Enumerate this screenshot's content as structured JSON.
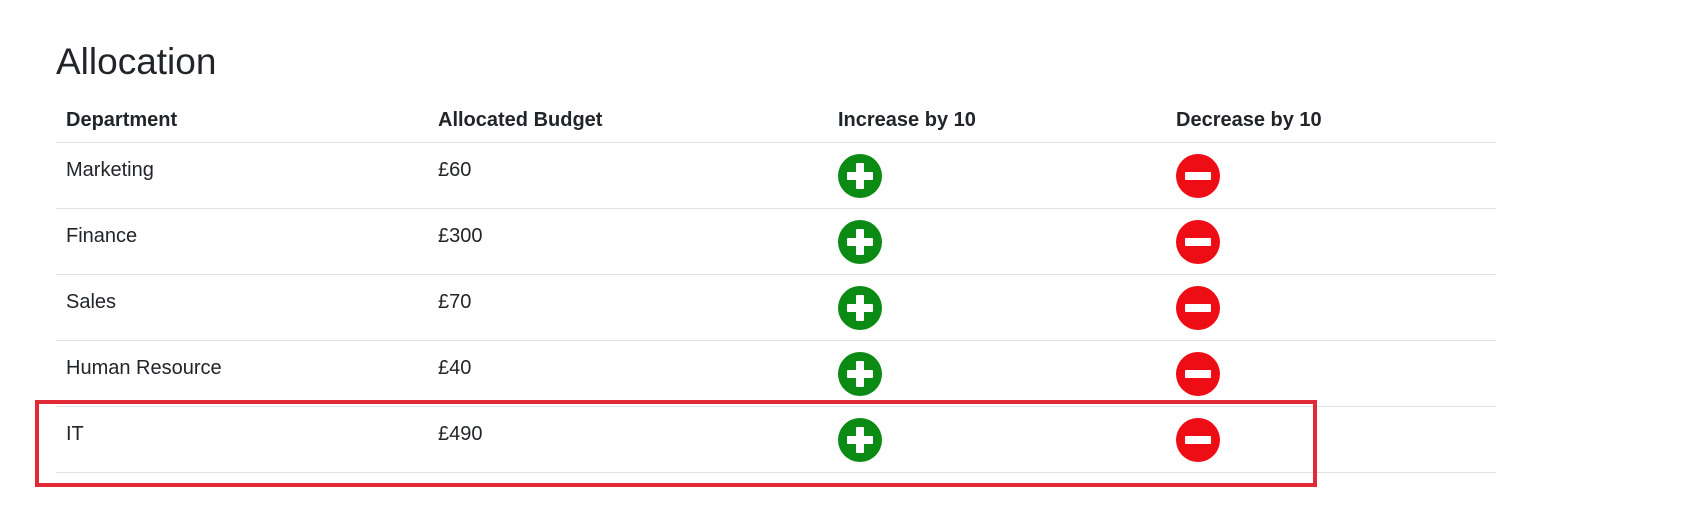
{
  "title": "Allocation",
  "table": {
    "headers": {
      "department": "Department",
      "budget": "Allocated Budget",
      "increase": "Increase by 10",
      "decrease": "Decrease by 10"
    },
    "rows": [
      {
        "department": "Marketing",
        "budget": "£60"
      },
      {
        "department": "Finance",
        "budget": "£300"
      },
      {
        "department": "Sales",
        "budget": "£70"
      },
      {
        "department": "Human Resource",
        "budget": "£40"
      },
      {
        "department": "IT",
        "budget": "£490"
      }
    ]
  },
  "icons": {
    "increase": "plus-circle-icon",
    "decrease": "minus-circle-icon"
  },
  "colors": {
    "increase": "#0b8a14",
    "decrease": "#ee0d14",
    "highlight": "#e02b37",
    "border": "#dee2e6",
    "text": "#212529"
  },
  "highlighted_row": "IT"
}
